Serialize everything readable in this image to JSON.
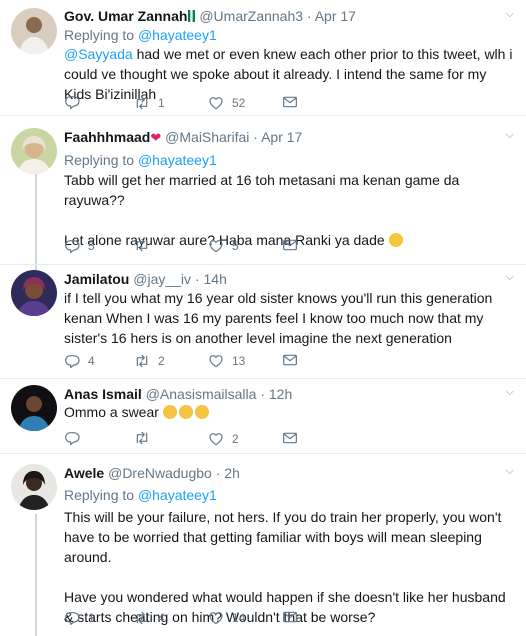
{
  "tweets": [
    {
      "name": "Gov. Umar Zannah",
      "handle": "@UmarZannah3",
      "time": "Apr 17",
      "replying_label": "Replying to",
      "replying_to": "@hayateey1",
      "mention": "@Sayyada",
      "text": " had we met or even knew each other prior to this tweet, wlh i could ve thought we spoke about it already. I intend the same for my Kids Bi'izinillah",
      "replies": "",
      "retweets": "1",
      "likes": "52"
    },
    {
      "name": "Faahhhmaad",
      "handle": "@MaiSharifai",
      "time": "Apr 17",
      "replying_label": "Replying to",
      "replying_to": "@hayateey1",
      "text_1": "Tabb will get her married at 16 toh metasani ma kenan game da rayuwa??",
      "text_2": "Let alone rayuwar aure? Haba mana Ranki ya dade",
      "replies": "5",
      "retweets": "",
      "likes": "5"
    },
    {
      "name": "Jamilatou",
      "handle": "@jay__iv",
      "time": "14h",
      "text": "if I tell you what my 16 year old sister knows you'll run this generation kenan When I was 16 my parents feel I know too much now that my sister's 16 hers is on another level imagine the next generation",
      "replies": "4",
      "retweets": "2",
      "likes": "13"
    },
    {
      "name": "Anas Ismail",
      "handle": "@Anasismailsalla",
      "time": "12h",
      "text": "Ommo a swear ",
      "replies": "",
      "retweets": "",
      "likes": "2"
    },
    {
      "name": "Awele",
      "handle": "@DreNwadugbo",
      "time": "2h",
      "replying_label": "Replying to",
      "replying_to": "@hayateey1",
      "text_1": "This will be your failure, not hers. If you do train her properly, you won't have to be worried that getting familiar with boys will mean sleeping around.",
      "text_2": "Have you wondered what would happen if she doesn't like her husband & starts cheating on him? Wouldn't that be worse?",
      "replies": "1",
      "retweets": "4",
      "likes": "14"
    }
  ],
  "separator": "·",
  "icons": {
    "reply": "reply-icon",
    "retweet": "retweet-icon",
    "like": "heart-icon",
    "message": "direct-message-icon",
    "caret": "chevron-down-icon"
  },
  "colors": {
    "link": "#1da1f2",
    "secondary": "#657786",
    "divider": "#e6ecf0",
    "thread_line": "#ccd6dd"
  }
}
